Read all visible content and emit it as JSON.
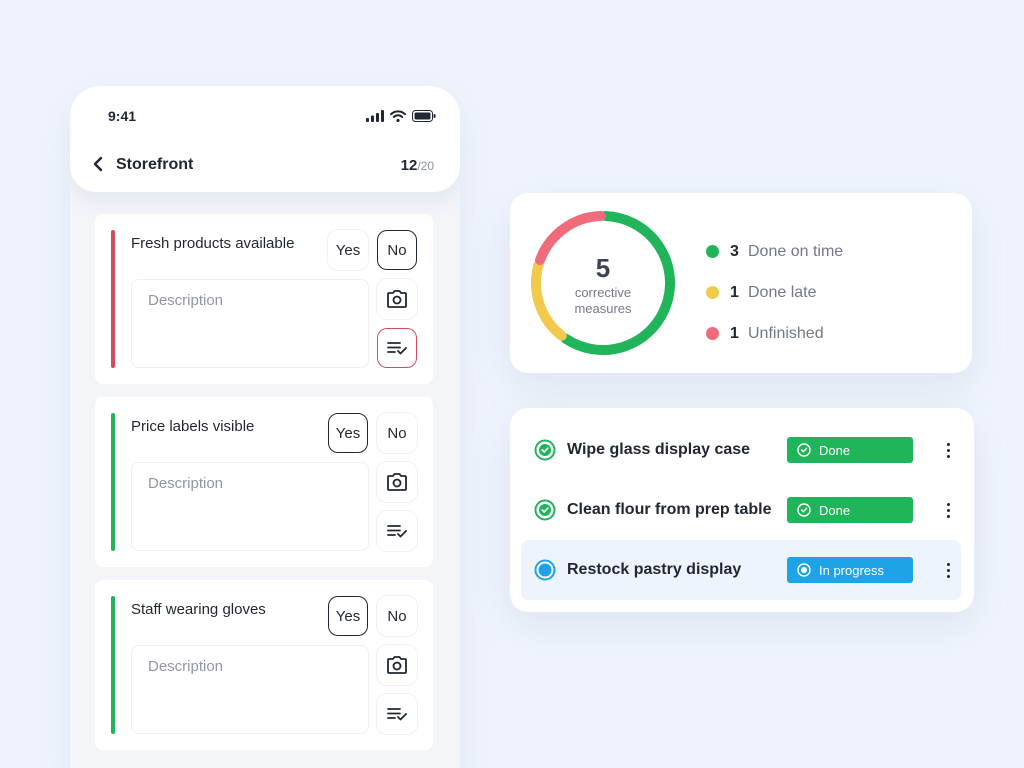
{
  "phone": {
    "status_time": "9:41",
    "title": "Storefront",
    "progress_current": "12",
    "progress_total": "/20",
    "description_placeholder": "Description",
    "items": [
      {
        "question": "Fresh products available",
        "yes_label": "Yes",
        "no_label": "No",
        "selected": "No",
        "bar_color": "#d44a5f"
      },
      {
        "question": "Price labels visible",
        "yes_label": "Yes",
        "no_label": "No",
        "selected": "Yes",
        "bar_color": "#21b55b"
      },
      {
        "question": "Staff wearing gloves",
        "yes_label": "Yes",
        "no_label": "No",
        "selected": "Yes",
        "bar_color": "#21b55b"
      }
    ]
  },
  "summary": {
    "total": "5",
    "total_label_line1": "corrective",
    "total_label_line2": "measures",
    "legend": [
      {
        "count": "3",
        "label": "Done on time",
        "color": "#21b55b"
      },
      {
        "count": "1",
        "label": "Done late",
        "color": "#f3c94c"
      },
      {
        "count": "1",
        "label": "Unfinished",
        "color": "#f06c7d"
      }
    ]
  },
  "tasks": [
    {
      "name": "Wipe glass display case",
      "status": "Done",
      "status_color": "#21b55b",
      "status_icon": "check-circle-icon"
    },
    {
      "name": "Clean flour from prep table",
      "status": "Done",
      "status_color": "#21b55b",
      "status_icon": "check-circle-icon"
    },
    {
      "name": "Restock pastry display",
      "status": "In progress",
      "status_color": "#1da3e8",
      "status_icon": "in-progress-icon"
    }
  ]
}
